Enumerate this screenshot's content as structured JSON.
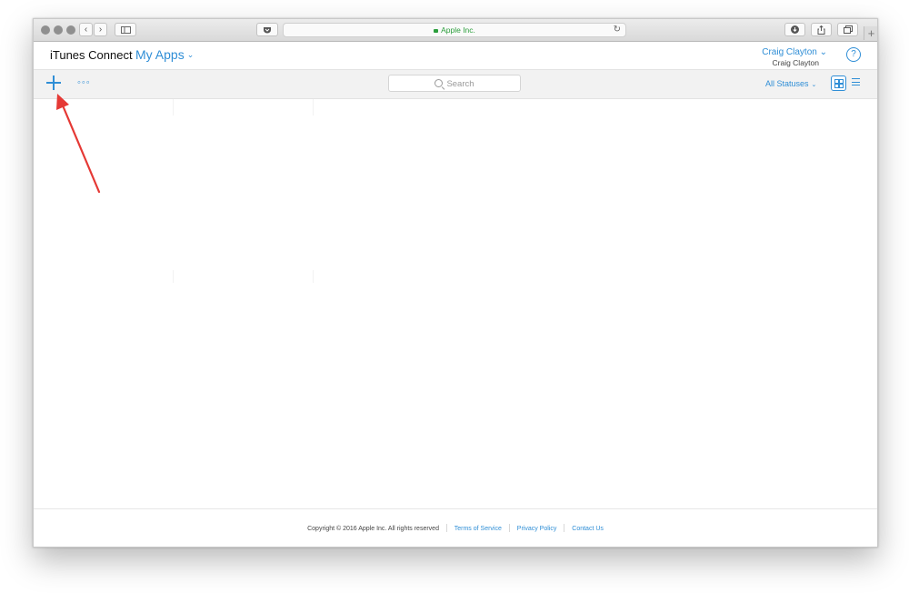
{
  "browser": {
    "address": "Apple Inc.",
    "new_tab_glyph": "+"
  },
  "header": {
    "brand": "iTunes Connect",
    "section": "My Apps",
    "section_chevron": "⌄",
    "user_name": "Craig Clayton",
    "user_chevron": "⌄",
    "user_sub": "Craig Clayton",
    "help_glyph": "?"
  },
  "toolbar": {
    "more_glyph": "◦◦◦",
    "search_placeholder": "Search",
    "status_filter": "All Statuses",
    "status_chevron": "⌄"
  },
  "footer": {
    "copyright": "Copyright © 2016 Apple Inc. All rights reserved",
    "links": [
      "Terms of Service",
      "Privacy Policy",
      "Contact Us"
    ]
  },
  "colors": {
    "accent": "#2f8ed6",
    "secure": "#2b9e3c",
    "annotation": "#e53935"
  }
}
